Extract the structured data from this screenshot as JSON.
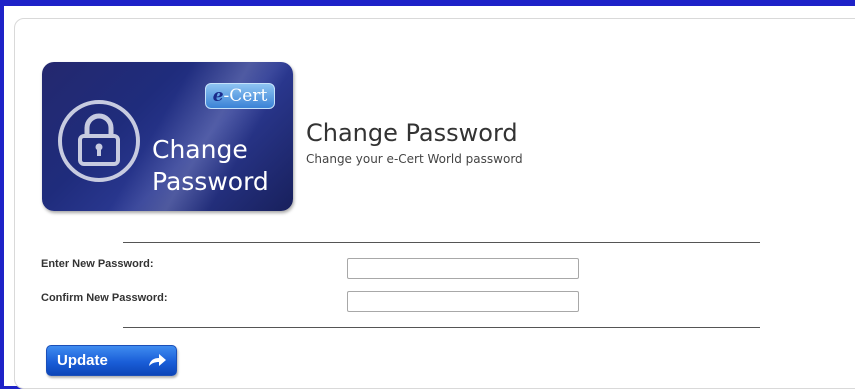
{
  "badge": {
    "tag_prefix": "e",
    "tag_text": "-Cert",
    "line1": "Change",
    "line2": "Password",
    "icon": "lock-icon"
  },
  "header": {
    "title": "Change Password",
    "subtitle": "Change your e-Cert World password"
  },
  "form": {
    "new_password_label": "Enter New Password:",
    "new_password_value": "",
    "confirm_password_label": "Confirm New Password:",
    "confirm_password_value": ""
  },
  "actions": {
    "update_label": "Update",
    "update_icon": "arrow-right-icon"
  },
  "colors": {
    "frame": "#1e22c8",
    "badge_bg": "#24286e",
    "button_bg": "#1a5ed8"
  }
}
